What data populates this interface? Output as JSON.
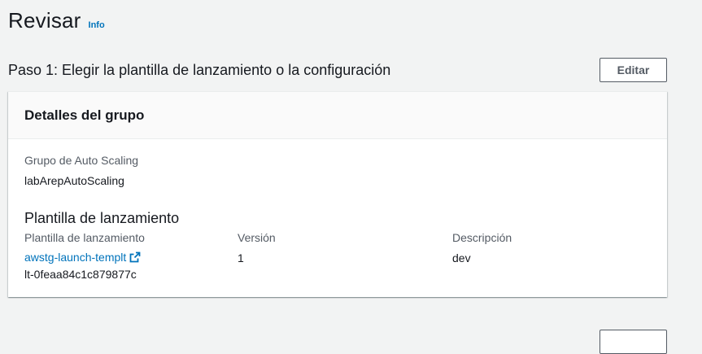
{
  "header": {
    "title": "Revisar",
    "info_label": "Info"
  },
  "step1": {
    "title": "Paso 1: Elegir la plantilla de lanzamiento o la configuración",
    "edit_label": "Editar",
    "card": {
      "title": "Detalles del grupo",
      "asg_label": "Grupo de Auto Scaling",
      "asg_value": "labArepAutoScaling",
      "template_section_title": "Plantilla de lanzamiento",
      "columns": {
        "template_label": "Plantilla de lanzamiento",
        "version_label": "Versión",
        "description_label": "Descripción"
      },
      "template_link": "awstg-launch-templt",
      "template_id": "lt-0feaa84c1c879877c",
      "version_value": "1",
      "description_value": "dev"
    }
  },
  "colors": {
    "link": "#0073bb",
    "text": "#16191f",
    "secondary_text": "#545b64",
    "background": "#f2f3f3"
  }
}
